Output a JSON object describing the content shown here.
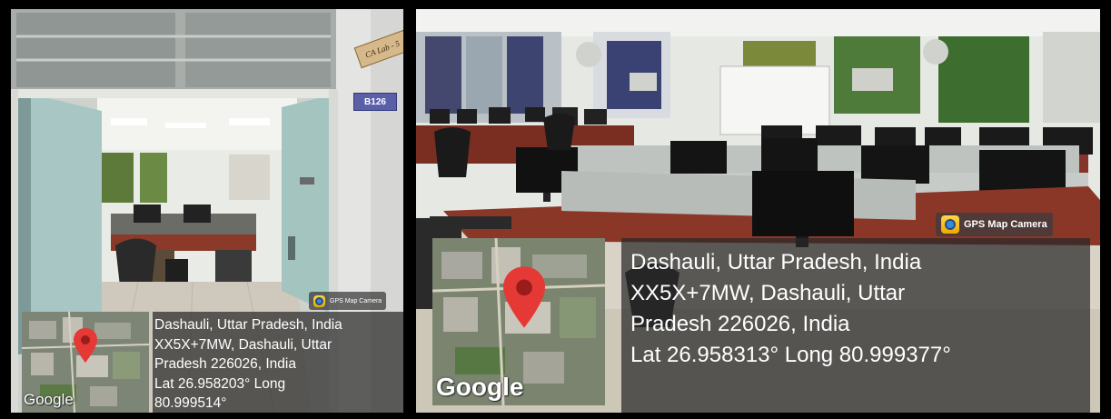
{
  "photos": [
    {
      "door_sign": "CA Lab - 5",
      "room_plate": "B126",
      "badge": "GPS Map Camera",
      "map_brand": "Google",
      "lines": [
        "Dashauli, Uttar Pradesh, India",
        "XX5X+7MW, Dashauli, Uttar",
        "Pradesh 226026, India",
        "Lat 26.958203° Long",
        "80.999514°"
      ]
    },
    {
      "badge": "GPS Map Camera",
      "map_brand": "Google",
      "lines": [
        "Dashauli, Uttar Pradesh, India",
        "XX5X+7MW, Dashauli, Uttar",
        "Pradesh 226026, India",
        "Lat 26.958313° Long 80.999377°"
      ]
    }
  ],
  "colors": {
    "pin": "#e53935",
    "overlay": "#3a3a3a",
    "desk": "#7a2e22",
    "wall": "#e8eae6"
  }
}
